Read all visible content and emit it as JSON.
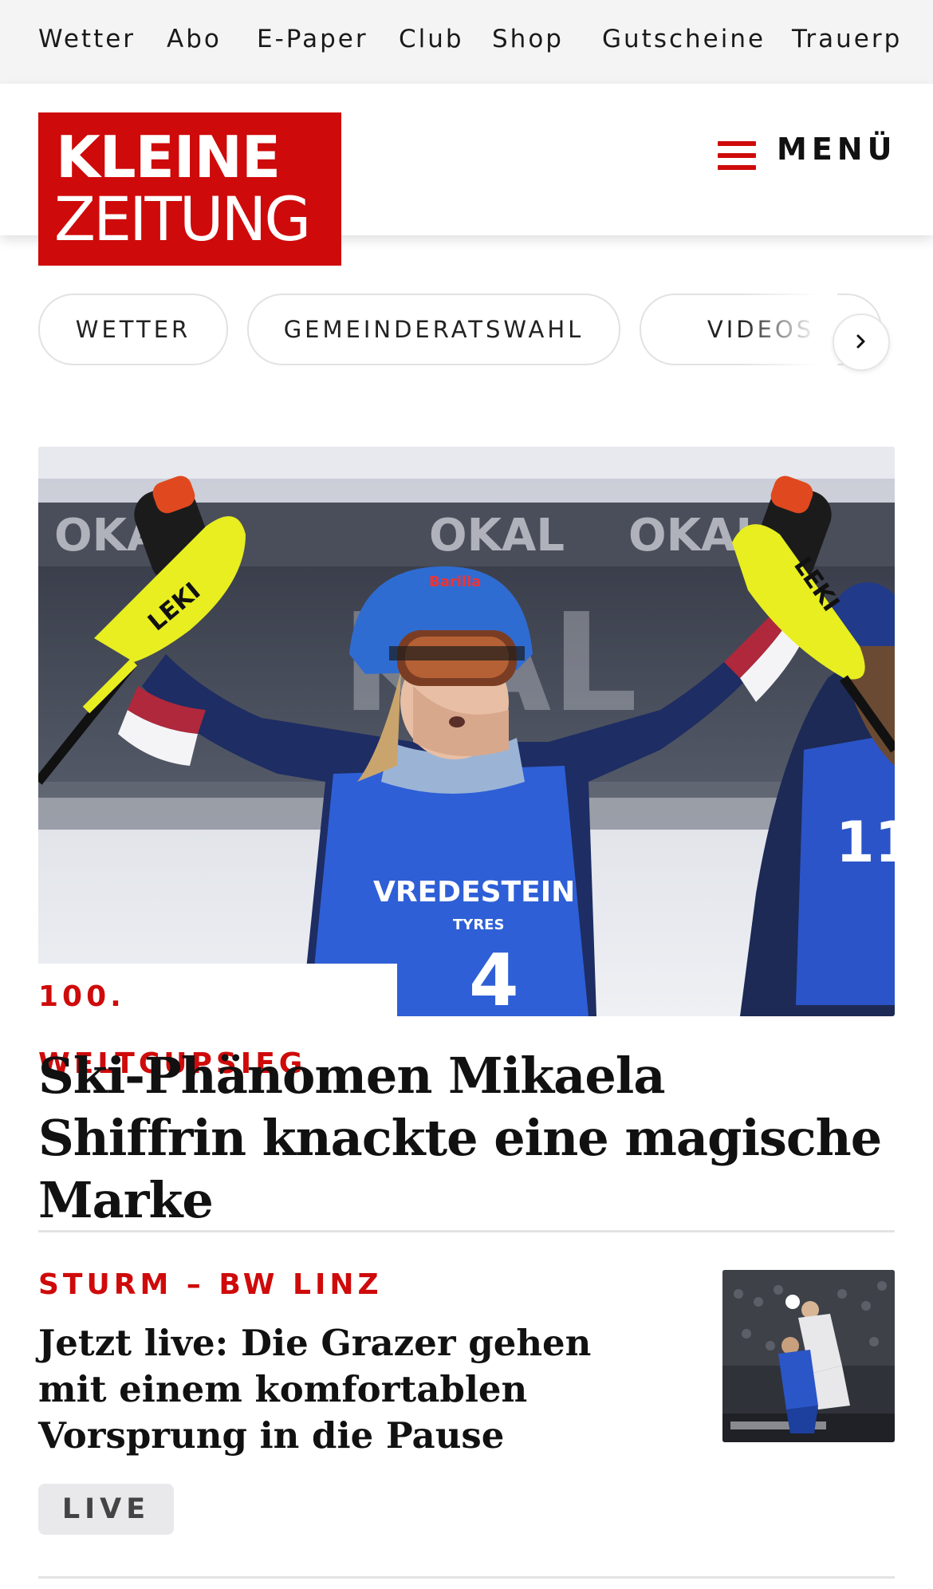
{
  "topnav": {
    "items": [
      "Wetter",
      "Abo",
      "E-Paper",
      "Club",
      "Shop",
      "Gutscheine",
      "Trauerp"
    ]
  },
  "header": {
    "logo_line1": "KLEINE",
    "logo_line2": "ZEITUNG",
    "menu_label": "MENÜ"
  },
  "chips": {
    "items": [
      "WETTER",
      "GEMEINDERATSWAHL",
      "VIDEOS"
    ]
  },
  "hero": {
    "kicker": "100. WELTCUPSIEG",
    "title": "Ski-Phänomen Mikaela Shiffrin knackte eine magische Marke",
    "bib_text": "VREDESTEIN",
    "bib_sub": "TYRES",
    "bib_number": "4",
    "pole_brand": "LEKI",
    "banner_text": "OKAL"
  },
  "article": {
    "kicker": "STURM – BW LINZ",
    "title": "Jetzt live: Die Grazer gehen mit einem komfortablen Vorsprung in die Pause",
    "badge": "LIVE"
  },
  "colors": {
    "brand_red": "#cf0a0a",
    "topnav_bg": "#f4f4f4",
    "live_badge_bg": "#e9e9ec"
  }
}
